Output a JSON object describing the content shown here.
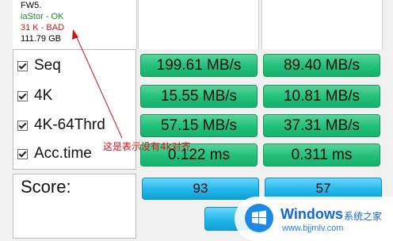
{
  "info": {
    "lines": [
      "FW5.",
      "iaStor - OK",
      "31 K - BAD",
      "111.79 GB"
    ]
  },
  "rows": [
    {
      "label": "Seq",
      "read": "199.61 MB/s",
      "write": "89.40 MB/s"
    },
    {
      "label": "4K",
      "read": "15.55 MB/s",
      "write": "10.81 MB/s"
    },
    {
      "label": "4K-64Thrd",
      "read": "57.15 MB/s",
      "write": "37.31 MB/s"
    },
    {
      "label": "Acc.time",
      "read": "0.122 ms",
      "write": "0.311 ms"
    }
  ],
  "score": {
    "label": "Score:",
    "read": "93",
    "write": "57"
  },
  "annotation": {
    "text": "这是表示没有4k对齐",
    "color": "#d01515"
  },
  "watermark": {
    "brand": "Windows",
    "subtitle": "系统之家",
    "url": "www.bjjmlv.com",
    "color": "#1565d8"
  },
  "colors": {
    "result_cell": "#1fc079",
    "score_cell": "#21b7eb",
    "bad_text": "#c41e1e",
    "ok_text": "#1a8a2a"
  }
}
